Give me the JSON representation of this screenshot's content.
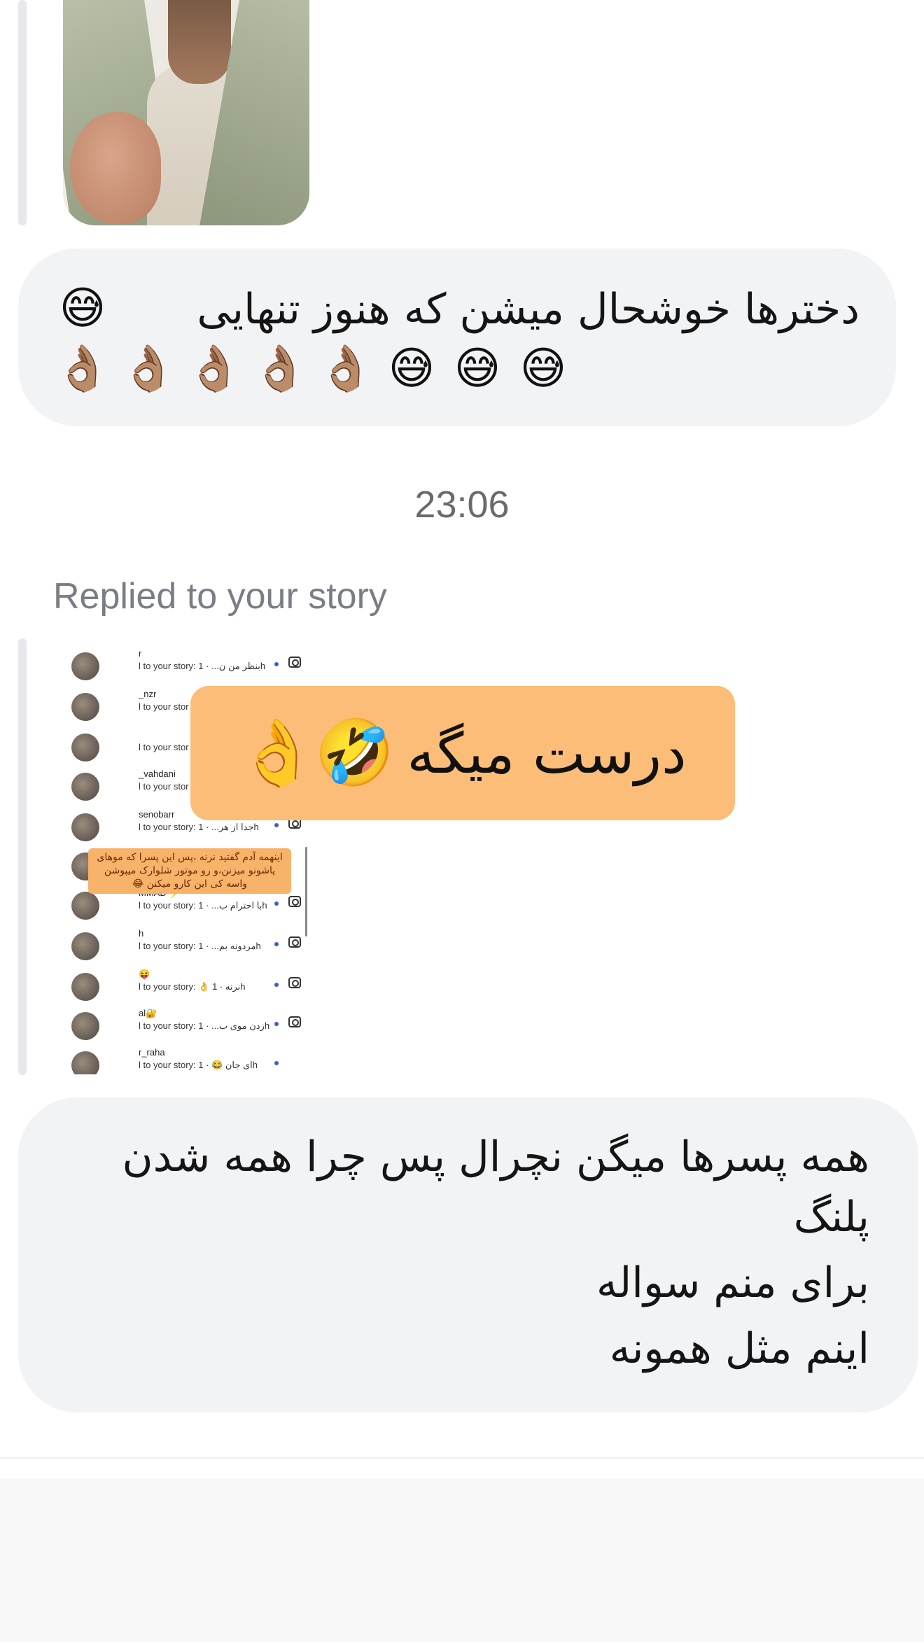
{
  "story_photo": {
    "alt_subject": ""
  },
  "message_1": {
    "text": "دخترها خوشحال میشن که هنوز تنهایی",
    "lead_emoji": "😅",
    "emoji_row": [
      "👌🏽",
      "👌🏽",
      "👌🏽",
      "👌🏽",
      "👌🏽",
      "😅",
      "😅",
      "😅"
    ]
  },
  "timestamp": "23:06",
  "reply_header": "Replied to your story",
  "story_screenshot": {
    "rows": [
      {
        "name": "r",
        "text": "l to your story: بنظر من ن... · 1h"
      },
      {
        "name": "_nzr",
        "text": "l to your stor"
      },
      {
        "name": "",
        "text": "l to your stor"
      },
      {
        "name": "_vahdani",
        "text": "l to your stor"
      },
      {
        "name": "senobarr",
        "text": "l to your story: جدا از هر... · 1h"
      },
      {
        "name": "",
        "text": ""
      },
      {
        "name": "MMAD ⚡",
        "text": "l to your story: با احترام ب... · 1h"
      },
      {
        "name": "h",
        "text": "l to your story: مردونه بم... · 1h"
      },
      {
        "name": "😝",
        "text": "l to your story: 👌 نرنه · 1h"
      },
      {
        "name": "al🔐",
        "text": "l to your story: زدن موی ب... · 1h"
      },
      {
        "name": "r_raha",
        "text": "l to your story: ای جان 😂 · 1h"
      }
    ],
    "note_text": "اینهمه آدم گفتید نرنه ،پس این پسرا که موهای پاشونو میزنن،و رو موتور شلوارک میپوشن واسه کی این کارو میکنن 😂"
  },
  "sticker": {
    "text": "درست میگه",
    "emojis": [
      "🤣",
      "👌"
    ]
  },
  "message_2": {
    "lines": [
      "همه پسرها میگن نچرال پس چرا همه شدن",
      "پلنگ",
      "برای منم سواله",
      "اینم مثل همونه"
    ]
  },
  "colors": {
    "bubble": "#f2f3f5",
    "sticker": "#fbbd77",
    "meta_text": "#7a7d85"
  }
}
